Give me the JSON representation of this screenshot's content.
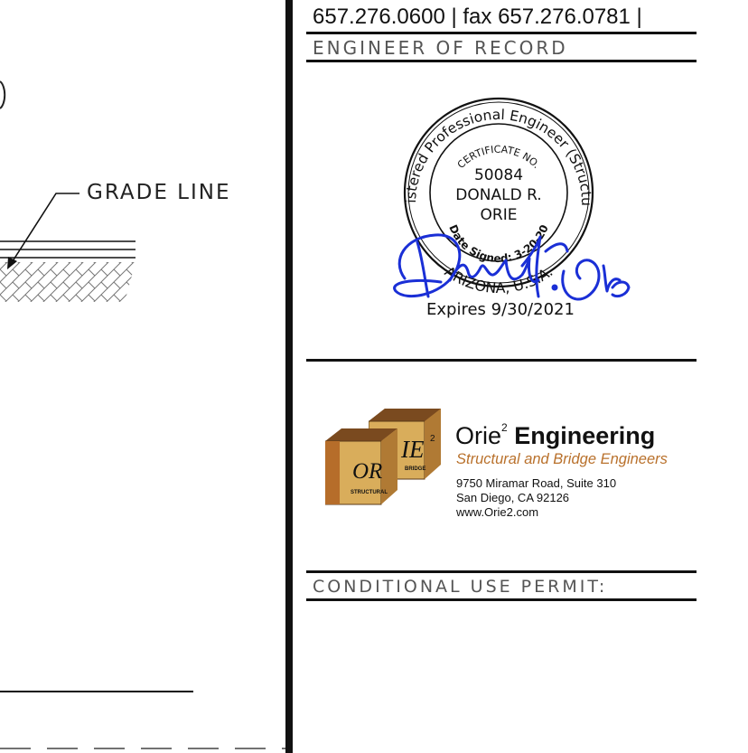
{
  "title_block": {
    "contact": "657.276.0600 | fax 657.276.0781 |",
    "engineer_of_record_label": "ENGINEER OF RECORD",
    "conditional_use_permit_label": "CONDITIONAL USE PERMIT:"
  },
  "drawing": {
    "grade_line_label": "GRADE LINE"
  },
  "seal": {
    "outer_text": "Registered Professional Engineer (Structural)",
    "certificate_label": "CERTIFICATE NO.",
    "number": "50084",
    "name_line1": "DONALD R.",
    "name_line2": "ORIE",
    "date_signed": "Date Signed: 3-20-20",
    "state": "ARIZONA, U.S.A.",
    "expires": "Expires 9/30/2021",
    "signature": "Donald R. Orie"
  },
  "company": {
    "logo_left_text": "OR",
    "logo_left_sub": "STRUCTURAL",
    "logo_right_text": "IE",
    "logo_right_sup": "2",
    "logo_right_sub": "BRIDGE",
    "name_prefix": "Orie",
    "name_sup": "2",
    "name_suffix": "Engineering",
    "tagline": "Structural and Bridge Engineers",
    "address_line1": "9750 Miramar Road, Suite 310",
    "address_line2": "San Diego, CA 92126",
    "website": "www.Orie2.com"
  },
  "colors": {
    "signature_ink": "#1a2fd6",
    "tagline": "#b9712c",
    "box_front": "#b66d2a",
    "box_top": "#8a5424",
    "box_face_light": "#d9ad5b"
  }
}
